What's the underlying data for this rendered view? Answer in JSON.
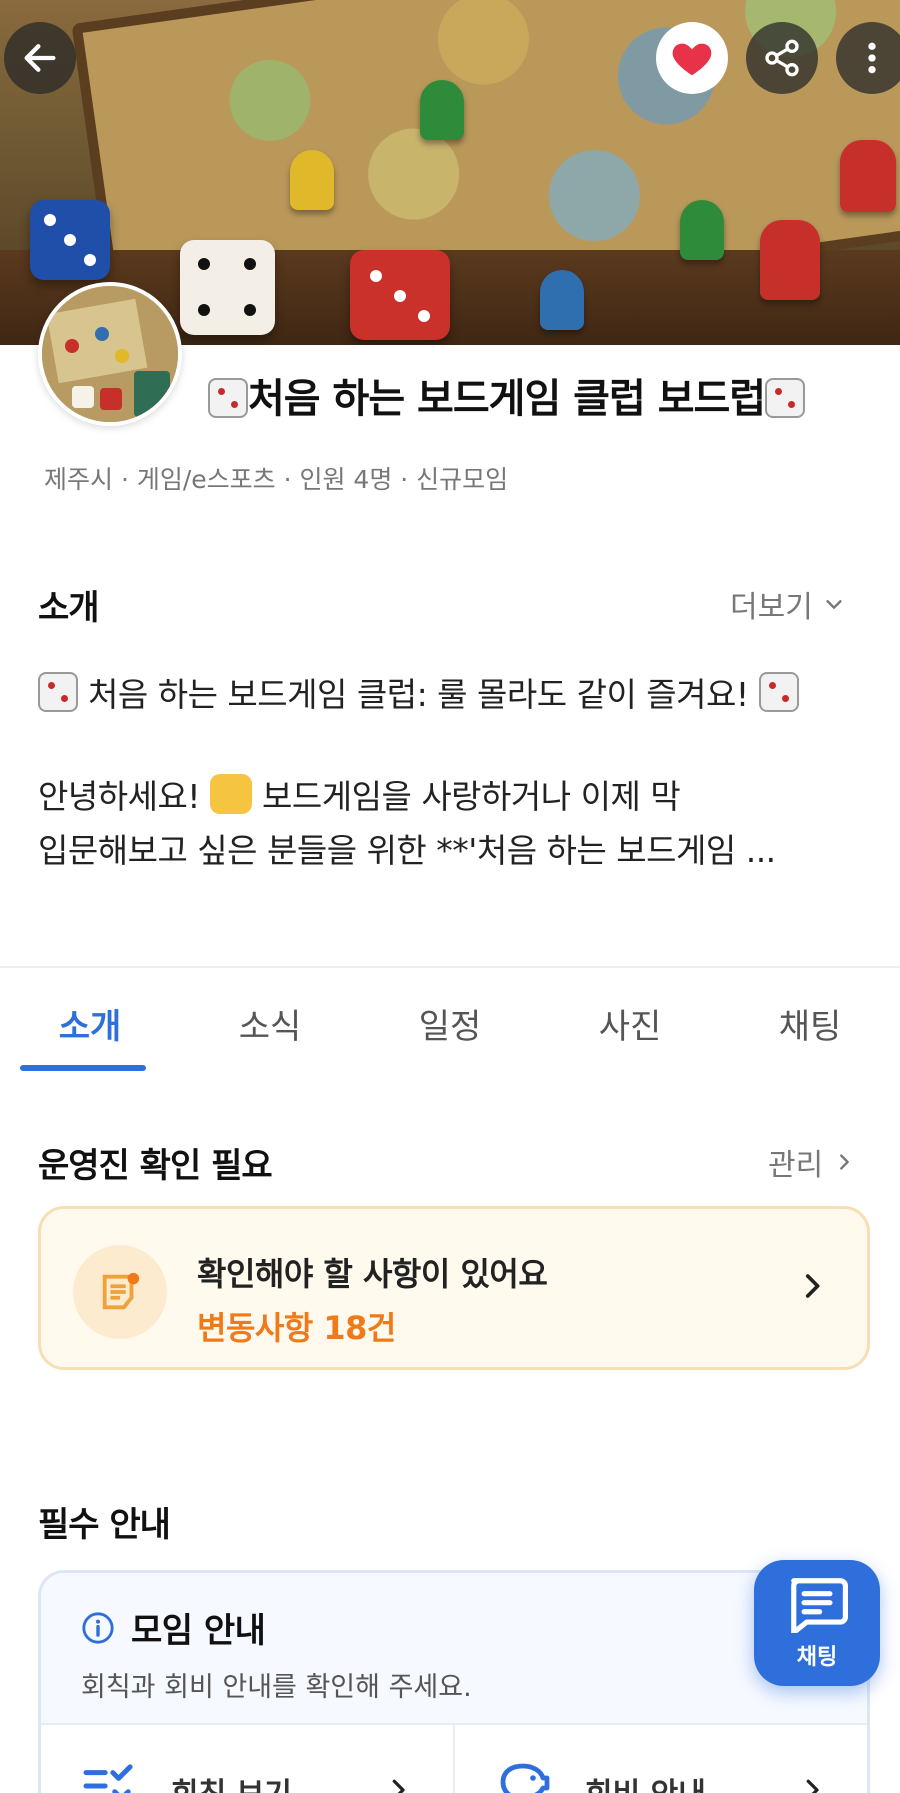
{
  "club": {
    "title": "처음 하는 보드게임 클럽 보드럽",
    "meta": "제주시 · 게임/e스포츠 · 인원 4명 · 신규모임"
  },
  "intro": {
    "heading": "소개",
    "more_label": "더보기",
    "line1": "처음 하는 보드게임 클럽: 룰 몰라도 같이 즐겨요!",
    "line2_before": "안녕하세요!",
    "line2_after": "보드게임을 사랑하거나 이제 막",
    "line3": "입문해보고 싶은 분들을 위한 **'처음 하는 보드게임 ..."
  },
  "tabs": [
    {
      "label": "소개",
      "active": true
    },
    {
      "label": "소식",
      "active": false
    },
    {
      "label": "일정",
      "active": false
    },
    {
      "label": "사진",
      "active": false
    },
    {
      "label": "채팅",
      "active": false
    }
  ],
  "admin": {
    "heading": "운영진 확인 필요",
    "manage_label": "관리",
    "notice_title": "확인해야 할 사항이 있어요",
    "notice_sub": "변동사항 18건"
  },
  "required": {
    "heading": "필수 안내",
    "card_title": "모임 안내",
    "card_desc": "회칙과 회비 안내를 확인해 주세요.",
    "rules_label": "회칙 보기",
    "fee_label": "회비 안내"
  },
  "fab": {
    "label": "채팅"
  },
  "colors": {
    "accent": "#2f6fdc",
    "heart": "#e8324a",
    "notice_orange": "#f07a1a",
    "notice_bg": "#fff9ee"
  },
  "icons": [
    "back-arrow-icon",
    "heart-icon",
    "share-icon",
    "more-vertical-icon",
    "chevron-down-icon",
    "chevron-right-icon",
    "memo-icon",
    "info-icon",
    "checklist-icon",
    "piggy-bank-icon",
    "chat-icon"
  ]
}
